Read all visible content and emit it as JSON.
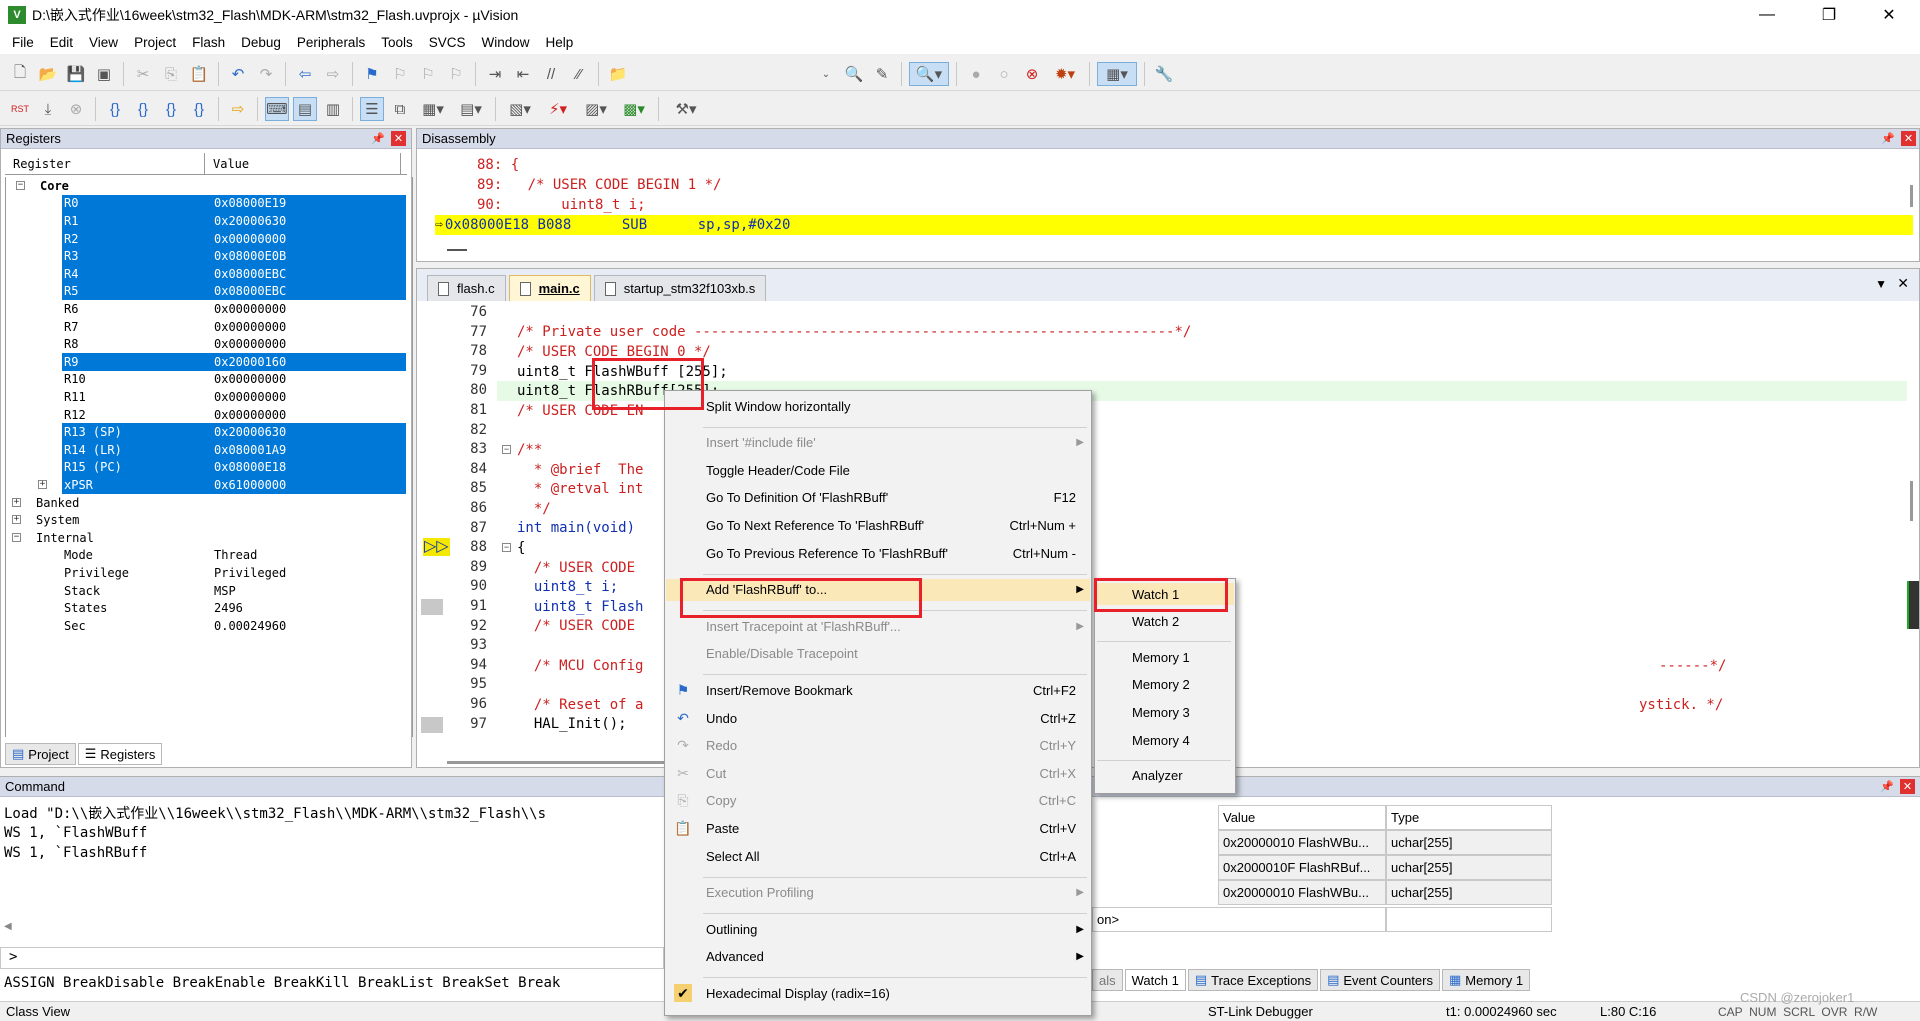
{
  "window": {
    "title": "D:\\嵌入式作业\\16week\\stm32_Flash\\MDK-ARM\\stm32_Flash.uvprojx - µVision",
    "app_icon": "V"
  },
  "window_controls": {
    "minimize": "—",
    "maximize": "❐",
    "close": "✕"
  },
  "menubar": [
    "File",
    "Edit",
    "View",
    "Project",
    "Flash",
    "Debug",
    "Peripherals",
    "Tools",
    "SVCS",
    "Window",
    "Help"
  ],
  "registers": {
    "title": "Registers",
    "col_register": "Register",
    "col_value": "Value",
    "core_label": "Core",
    "rows": [
      {
        "name": "R0",
        "value": "0x08000E19",
        "sel": true
      },
      {
        "name": "R1",
        "value": "0x20000630",
        "sel": true
      },
      {
        "name": "R2",
        "value": "0x00000000",
        "sel": true
      },
      {
        "name": "R3",
        "value": "0x08000E0B",
        "sel": true
      },
      {
        "name": "R4",
        "value": "0x08000EBC",
        "sel": true
      },
      {
        "name": "R5",
        "value": "0x08000EBC",
        "sel": true
      },
      {
        "name": "R6",
        "value": "0x00000000",
        "sel": false
      },
      {
        "name": "R7",
        "value": "0x00000000",
        "sel": false
      },
      {
        "name": "R8",
        "value": "0x00000000",
        "sel": false
      },
      {
        "name": "R9",
        "value": "0x20000160",
        "sel": true
      },
      {
        "name": "R10",
        "value": "0x00000000",
        "sel": false
      },
      {
        "name": "R11",
        "value": "0x00000000",
        "sel": false
      },
      {
        "name": "R12",
        "value": "0x00000000",
        "sel": false
      },
      {
        "name": "R13 (SP)",
        "value": "0x20000630",
        "sel": true
      },
      {
        "name": "R14 (LR)",
        "value": "0x080001A9",
        "sel": true
      },
      {
        "name": "R15 (PC)",
        "value": "0x08000E18",
        "sel": true
      },
      {
        "name": "xPSR",
        "value": "0x61000000",
        "sel": true
      }
    ],
    "groups": [
      "Banked",
      "System",
      "Internal"
    ],
    "internal": [
      {
        "name": "Mode",
        "value": "Thread"
      },
      {
        "name": "Privilege",
        "value": "Privileged"
      },
      {
        "name": "Stack",
        "value": "MSP"
      },
      {
        "name": "States",
        "value": "2496"
      },
      {
        "name": "Sec",
        "value": "0.00024960"
      }
    ],
    "tabs": [
      "Project",
      "Registers"
    ]
  },
  "disassembly": {
    "title": "Disassembly",
    "lines": [
      "88: {",
      "89:   /* USER CODE BEGIN 1 */",
      "90:       uint8_t i;"
    ],
    "current": "0x08000E18 B088      SUB      sp,sp,#0x20"
  },
  "editor": {
    "tabs": [
      "flash.c",
      "main.c",
      "startup_stm32f103xb.s"
    ],
    "lines": [
      {
        "n": "76",
        "t": ""
      },
      {
        "n": "77",
        "t": "/* Private user code ---------------------------------------------------------*/",
        "c": "cm"
      },
      {
        "n": "78",
        "t": "/* USER CODE BEGIN 0 */",
        "c": "cm"
      },
      {
        "n": "79",
        "t": "uint8_t FlashWBuff [255];"
      },
      {
        "n": "80",
        "t": "uint8_t FlashRBuff[255];"
      },
      {
        "n": "81",
        "t": "/* USER CODE EN",
        "c": "cm"
      },
      {
        "n": "82",
        "t": ""
      },
      {
        "n": "83",
        "t": "/**",
        "c": "cm"
      },
      {
        "n": "84",
        "t": "  * @brief  The",
        "c": "cm"
      },
      {
        "n": "85",
        "t": "  * @retval int",
        "c": "cm"
      },
      {
        "n": "86",
        "t": "  */",
        "c": "cm"
      },
      {
        "n": "87",
        "t": "int main(void)"
      },
      {
        "n": "88",
        "t": "{"
      },
      {
        "n": "89",
        "t": "  /* USER CODE",
        "c": "cm"
      },
      {
        "n": "90",
        "t": "  uint8_t i;"
      },
      {
        "n": "91",
        "t": "  uint8_t Flash"
      },
      {
        "n": "92",
        "t": "  /* USER CODE",
        "c": "cm"
      },
      {
        "n": "93",
        "t": ""
      },
      {
        "n": "94",
        "t": "  /* MCU Config",
        "c": "cm"
      },
      {
        "n": "95",
        "t": ""
      },
      {
        "n": "96",
        "t": "  /* Reset of a",
        "c": "cm"
      },
      {
        "n": "97",
        "t": "  HAL_Init();"
      }
    ],
    "tail_94": "------*/",
    "tail_96": "ystick. */"
  },
  "context_menu": [
    {
      "label": "Split Window horizontally",
      "shortcut": "",
      "dis": false
    },
    {
      "sep": true
    },
    {
      "label": "Insert '#include file'",
      "shortcut": "",
      "dis": true,
      "sub": true
    },
    {
      "label": "Toggle Header/Code File",
      "shortcut": "",
      "dis": false
    },
    {
      "label": "Go To Definition Of 'FlashRBuff'",
      "shortcut": "F12",
      "dis": false
    },
    {
      "label": "Go To Next Reference To 'FlashRBuff'",
      "shortcut": "Ctrl+Num +",
      "dis": false
    },
    {
      "label": "Go To Previous Reference To 'FlashRBuff'",
      "shortcut": "Ctrl+Num -",
      "dis": false
    },
    {
      "sep": true
    },
    {
      "label": "Add 'FlashRBuff' to...",
      "shortcut": "",
      "dis": false,
      "sub": true,
      "hl": true
    },
    {
      "sep": true
    },
    {
      "label": "Insert Tracepoint at 'FlashRBuff'...",
      "shortcut": "",
      "dis": true,
      "sub": true
    },
    {
      "label": "Enable/Disable Tracepoint",
      "shortcut": "",
      "dis": true
    },
    {
      "sep": true
    },
    {
      "label": "Insert/Remove Bookmark",
      "shortcut": "Ctrl+F2",
      "dis": false,
      "icon": "bookmark"
    },
    {
      "label": "Undo",
      "shortcut": "Ctrl+Z",
      "dis": false,
      "icon": "undo"
    },
    {
      "label": "Redo",
      "shortcut": "Ctrl+Y",
      "dis": true,
      "icon": "redo"
    },
    {
      "label": "Cut",
      "shortcut": "Ctrl+X",
      "dis": true,
      "icon": "cut"
    },
    {
      "label": "Copy",
      "shortcut": "Ctrl+C",
      "dis": true,
      "icon": "copy"
    },
    {
      "label": "Paste",
      "shortcut": "Ctrl+V",
      "dis": false,
      "icon": "paste"
    },
    {
      "label": "Select All",
      "shortcut": "Ctrl+A",
      "dis": false
    },
    {
      "sep": true
    },
    {
      "label": "Execution Profiling",
      "shortcut": "",
      "dis": true,
      "sub": true
    },
    {
      "sep": true
    },
    {
      "label": "Outlining",
      "shortcut": "",
      "dis": false,
      "sub": true
    },
    {
      "label": "Advanced",
      "shortcut": "",
      "dis": false,
      "sub": true
    },
    {
      "sep": true
    },
    {
      "label": "Hexadecimal Display (radix=16)",
      "shortcut": "",
      "dis": false,
      "icon": "check"
    }
  ],
  "submenu": [
    {
      "label": "Watch 1"
    },
    {
      "label": "Watch 2"
    },
    {
      "sep": true
    },
    {
      "label": "Memory 1"
    },
    {
      "label": "Memory 2"
    },
    {
      "label": "Memory 3"
    },
    {
      "label": "Memory 4"
    },
    {
      "sep": true
    },
    {
      "label": "Analyzer"
    }
  ],
  "command": {
    "title": "Command",
    "lines": [
      "Load \"D:\\\\嵌入式作业\\\\16week\\\\stm32_Flash\\\\MDK-ARM\\\\stm32_Flash\\\\s",
      "WS 1, `FlashWBuff",
      "WS 1, `FlashRBuff"
    ],
    "prompt": ">",
    "hint": "ASSIGN BreakDisable BreakEnable BreakKill BreakList BreakSet Break"
  },
  "watch": {
    "col_value": "Value",
    "col_type": "Type",
    "rows": [
      {
        "value": "0x20000010 FlashWBu...",
        "type": "uchar[255]"
      },
      {
        "value": "0x2000010F FlashRBuf...",
        "type": "uchar[255]"
      },
      {
        "value": "0x20000010 FlashWBu...",
        "type": "uchar[255]"
      }
    ],
    "enter_expr": "on>",
    "tabs": [
      "als",
      "Watch 1",
      "Trace Exceptions",
      "Event Counters",
      "Memory 1"
    ]
  },
  "status": {
    "left": "Class View",
    "debugger": "ST-Link Debugger",
    "time": "t1: 0.00024960 sec",
    "pos": "L:80 C:16",
    "flags": "CAP  NUM  SCRL  OVR  R/W"
  },
  "watermark": "CSDN @zerojoker1"
}
